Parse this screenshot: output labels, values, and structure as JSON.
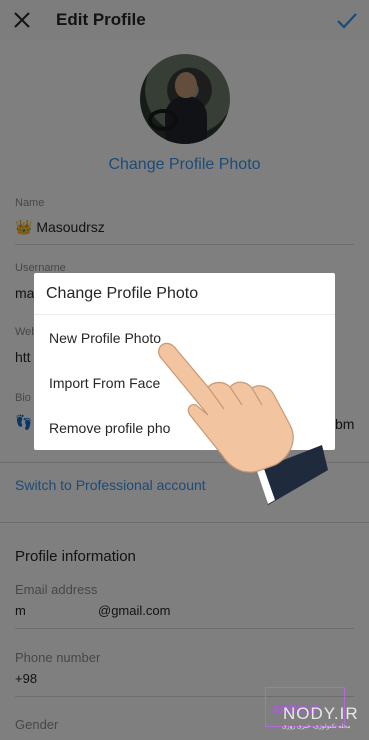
{
  "header": {
    "title": "Edit Profile",
    "close_icon": "close-icon",
    "done_icon": "checkmark-icon",
    "accent": "#3897f0"
  },
  "profile": {
    "change_photo_label": "Change Profile Photo"
  },
  "fields": {
    "name": {
      "label": "Name",
      "value": "👑 Masoudrsz"
    },
    "username": {
      "label": "Username",
      "value": "ma"
    },
    "website": {
      "label": "Web",
      "value": "htt"
    },
    "bio": {
      "label": "Bio",
      "value": "👣",
      "value_tail": "bm"
    }
  },
  "switch_link": "Switch to Professional account",
  "profile_info": {
    "title": "Profile information",
    "email": {
      "label": "Email address",
      "value_start": "m",
      "value_end": "@gmail.com"
    },
    "phone": {
      "label": "Phone number",
      "value": "+98"
    },
    "gender": {
      "label": "Gender"
    }
  },
  "dialog": {
    "title": "Change Profile Photo",
    "options": [
      "New Profile Photo",
      "Import From Face",
      "Remove profile pho"
    ]
  },
  "watermark": {
    "anbir": "anbir.ir",
    "nody": "NODY.IR",
    "sub": "مجله تکنولوژی، خبری روزی"
  }
}
